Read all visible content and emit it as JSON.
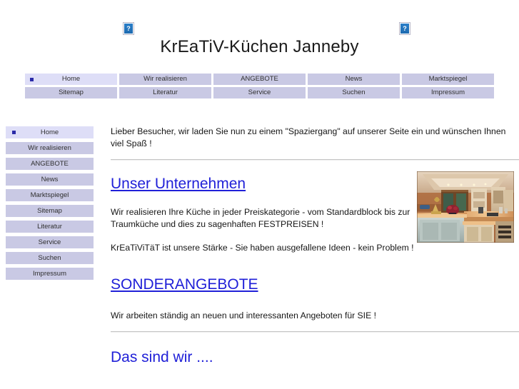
{
  "site": {
    "title": "KrEaTiV-Küchen Janneby"
  },
  "header": {
    "broken_image_left": "broken-image-placeholder",
    "broken_image_right": "broken-image-placeholder",
    "placeholder_glyph": "?"
  },
  "topnav": {
    "row1": [
      {
        "label": "Home",
        "active": true
      },
      {
        "label": "Wir realisieren",
        "active": false
      },
      {
        "label": "ANGEBOTE",
        "active": false
      },
      {
        "label": "News",
        "active": false
      },
      {
        "label": "Marktspiegel",
        "active": false
      }
    ],
    "row2": [
      {
        "label": "Sitemap",
        "active": false
      },
      {
        "label": "Literatur",
        "active": false
      },
      {
        "label": "Service",
        "active": false
      },
      {
        "label": "Suchen",
        "active": false
      },
      {
        "label": "Impressum",
        "active": false
      }
    ]
  },
  "sidebar": {
    "items": [
      {
        "label": "Home",
        "active": true
      },
      {
        "label": "Wir realisieren",
        "active": false
      },
      {
        "label": "ANGEBOTE",
        "active": false
      },
      {
        "label": "News",
        "active": false
      },
      {
        "label": "Marktspiegel",
        "active": false
      },
      {
        "label": "Sitemap",
        "active": false
      },
      {
        "label": "Literatur",
        "active": false
      },
      {
        "label": "Service",
        "active": false
      },
      {
        "label": "Suchen",
        "active": false
      },
      {
        "label": "Impressum",
        "active": false
      }
    ]
  },
  "main": {
    "intro": "Lieber Besucher, wir laden Sie nun zu einem \"Spaziergang\" auf unserer Seite ein und wünschen Ihnen viel Spaß !",
    "heading_unternehmen": "Unser Unternehmen",
    "para_1": "Wir realisieren Ihre Küche in jeder Preiskategorie - vom Standardblock bis zur Traumküche und dies zu sagenhaften FESTPREISEN !",
    "para_2": "KrEaTiViTäT ist unsere Stärke - Sie haben ausgefallene Ideen - kein Problem !",
    "heading_sonderangebote": "SONDERANGEBOTE",
    "para_3": "Wir arbeiten ständig an neuen und interessanten Angeboten für SIE !",
    "heading_daswir": "Das sind wir ....",
    "photo_alt": "kitchen-interior-photo"
  },
  "colors": {
    "nav_default": "#c9c9e4",
    "nav_active": "#dedef7",
    "bullet": "#2b2ba8",
    "link": "#2020d8",
    "rule": "#c4c4c4"
  }
}
